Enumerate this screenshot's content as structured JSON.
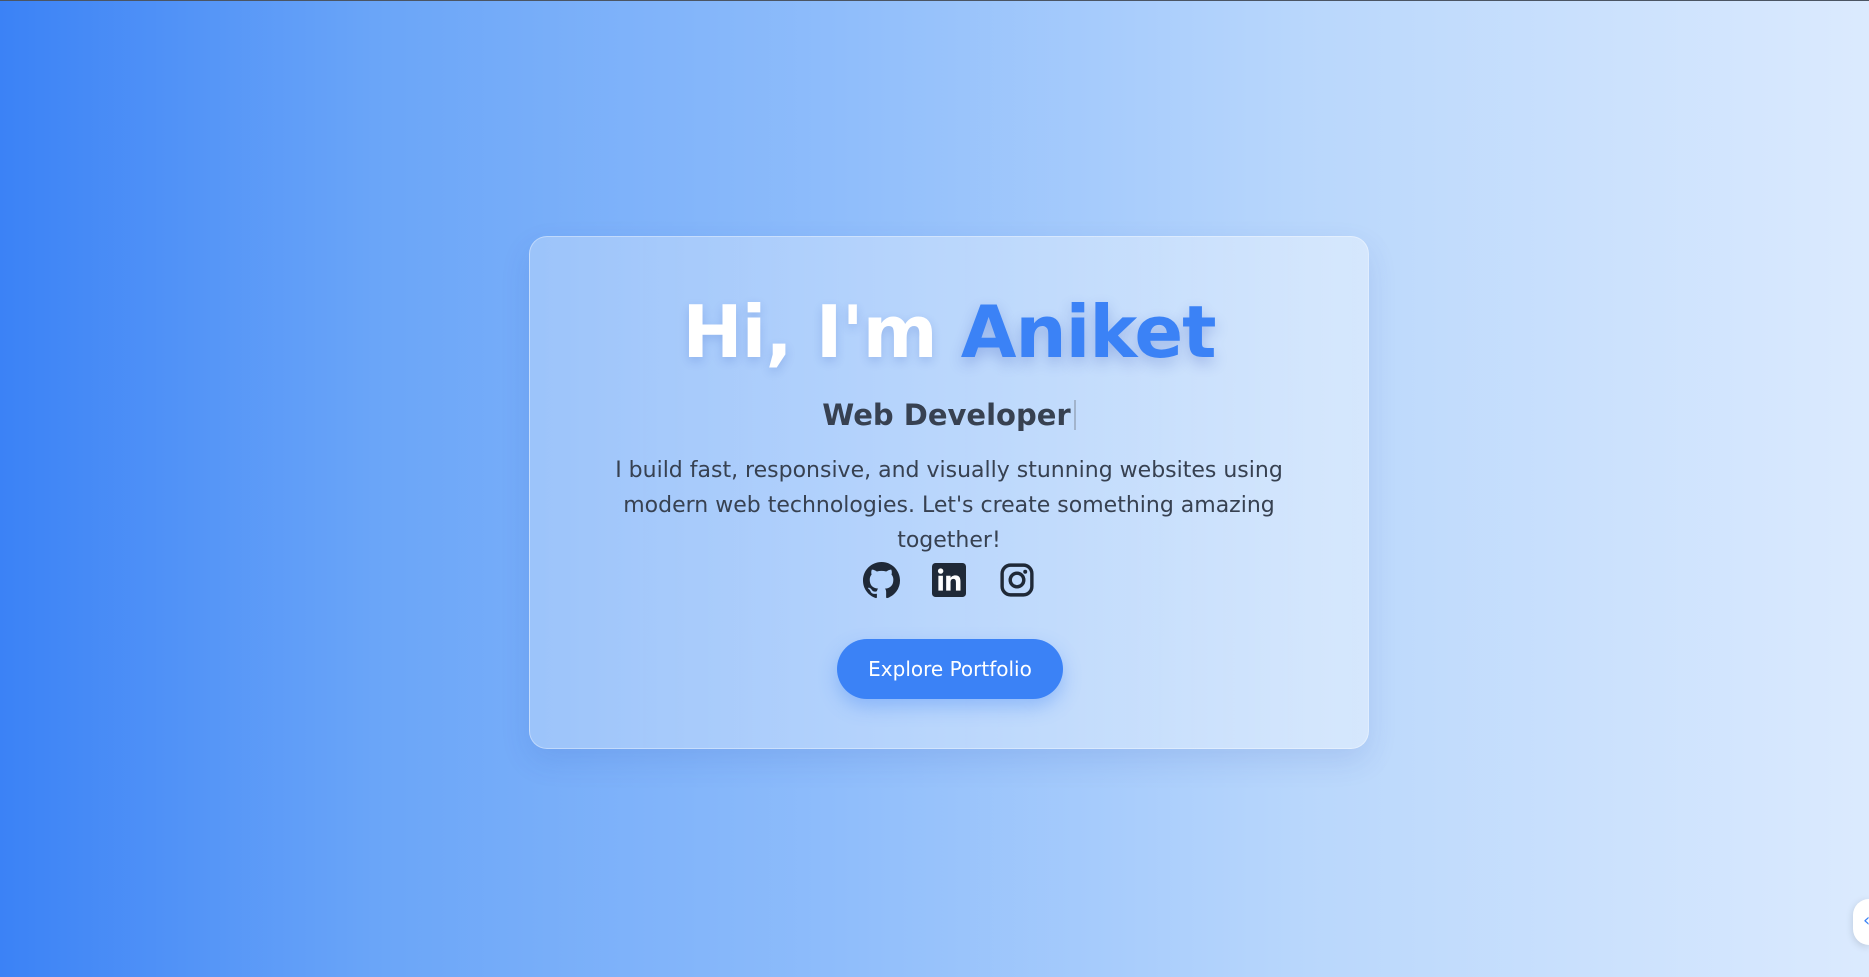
{
  "hero": {
    "greeting": "Hi, I'm ",
    "name": "Aniket",
    "role": "Web Developer",
    "description": "I build fast, responsive, and visually stunning websites using modern web technologies. Let's create something amazing together!",
    "cta_label": "Explore Portfolio"
  },
  "socials": [
    {
      "icon": "github-icon",
      "label": "GitHub"
    },
    {
      "icon": "linkedin-icon",
      "label": "LinkedIn"
    },
    {
      "icon": "instagram-icon",
      "label": "Instagram"
    }
  ],
  "colors": {
    "accent": "#3b82f6",
    "text_dark": "#374151",
    "icon": "#1f2937",
    "gradient_start": "#3b82f6",
    "gradient_end": "#dbeafe"
  }
}
